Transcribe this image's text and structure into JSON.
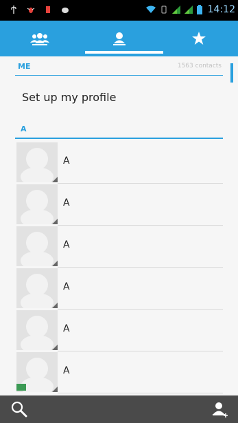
{
  "status_bar": {
    "time": "14:12",
    "icons": [
      "usb-icon",
      "bug-icon",
      "sim-icon",
      "android-icon",
      "wifi-icon",
      "vibrate-icon",
      "signal-icon",
      "signal-icon-2",
      "battery-icon"
    ]
  },
  "tabs": [
    {
      "name": "groups",
      "icon": "group-icon"
    },
    {
      "name": "contacts",
      "icon": "person-icon",
      "selected": true
    },
    {
      "name": "favorites",
      "icon": "star-icon"
    }
  ],
  "me_section": {
    "label": "ME",
    "count": "1563 contacts",
    "profile_text": "Set up my profile"
  },
  "a_section": {
    "label": "A"
  },
  "contacts": [
    {
      "name": "A"
    },
    {
      "name": "A"
    },
    {
      "name": "A"
    },
    {
      "name": "A"
    },
    {
      "name": "A"
    },
    {
      "name": "A"
    }
  ],
  "bottom_bar": {
    "icons": [
      "search-icon",
      "add-contact-icon"
    ]
  },
  "colors": {
    "accent": "#2aa0de",
    "bottom_bar": "#4a4a4a",
    "status_bar": "#000000"
  }
}
